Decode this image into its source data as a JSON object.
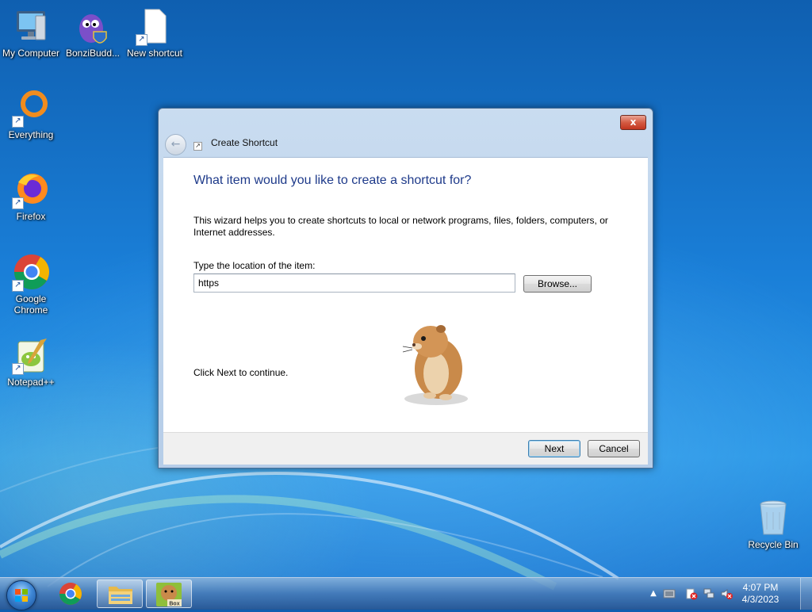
{
  "desktop": {
    "icons": [
      {
        "label": "My Computer",
        "icon": "computer-icon"
      },
      {
        "label": "BonziBudd...",
        "icon": "bonzibuddy-icon"
      },
      {
        "label": "New shortcut",
        "icon": "file-shortcut-icon"
      },
      {
        "label": "Everything",
        "icon": "everything-icon"
      },
      {
        "label": "Firefox",
        "icon": "firefox-icon"
      },
      {
        "label": "Google Chrome",
        "icon": "chrome-icon"
      },
      {
        "label": "Notepad++",
        "icon": "notepadpp-icon"
      },
      {
        "label": "Recycle Bin",
        "icon": "recycle-bin-icon"
      }
    ]
  },
  "dialog": {
    "title": "Create Shortcut",
    "close_label": "x",
    "heading": "What item would you like to create a shortcut for?",
    "description": "This wizard helps you to create shortcuts to local or network programs, files, folders, computers, or Internet addresses.",
    "field_label": "Type the location of the item:",
    "location_value": "https",
    "browse_label": "Browse...",
    "continue_text": "Click Next to continue.",
    "next_label": "Next",
    "cancel_label": "Cancel"
  },
  "taskbar": {
    "pinned": [
      "start-orb",
      "chrome-icon",
      "explorer-icon",
      "box-app-icon"
    ],
    "active_app_label": "Box",
    "clock_time": "4:07 PM",
    "clock_date": "4/3/2023"
  },
  "colors": {
    "heading": "#1e3a8a",
    "close_button": "#c9412a",
    "desktop": "#1a7fd8"
  }
}
